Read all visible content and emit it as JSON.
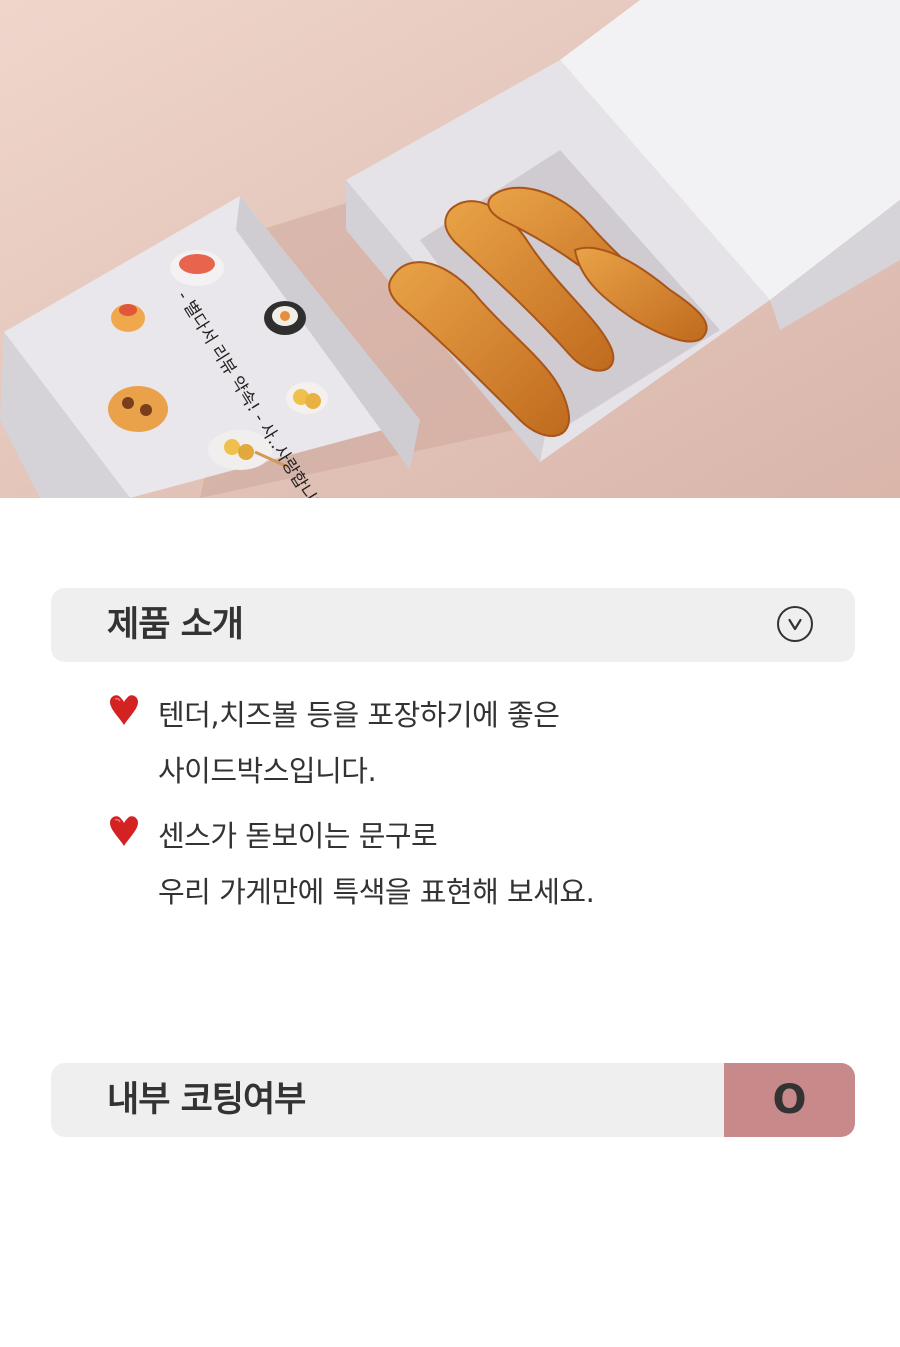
{
  "product_intro": {
    "title": "제품 소개",
    "toggle_icon": "chevron-down-circle-icon",
    "items": [
      {
        "icon": "heart-icon",
        "line1": "텐더,치즈볼 등을 포장하기에 좋은",
        "line2": "사이드박스입니다."
      },
      {
        "icon": "heart-icon",
        "line1": "센스가 돋보이는 문구로",
        "line2": "우리 가게만에 특색을 표현해 보세요."
      }
    ]
  },
  "coating": {
    "label": "내부 코팅여부",
    "value": "O"
  },
  "photo": {
    "box_lettering": "- 별다서 리뷰 약속! - 사..사랑합니다 :)"
  },
  "colors": {
    "bar_bg": "#efefef",
    "coating_badge": "#c8898a",
    "heart": "#d42222",
    "text": "#333333"
  }
}
